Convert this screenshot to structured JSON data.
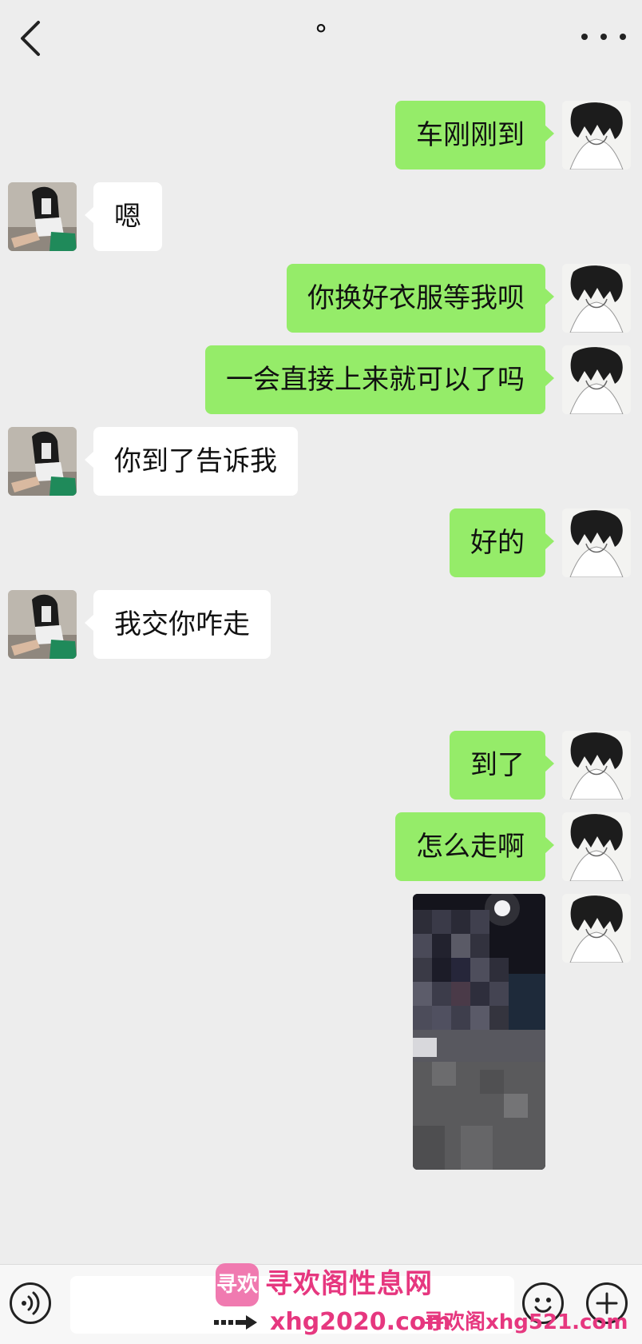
{
  "nav": {
    "title": "°"
  },
  "messages": [
    {
      "side": "me",
      "text": "车刚刚到"
    },
    {
      "side": "her",
      "text": "嗯"
    },
    {
      "side": "me",
      "text": "你换好衣服等我呗"
    },
    {
      "side": "me",
      "text": "一会直接上来就可以了吗"
    },
    {
      "side": "her",
      "text": "你到了告诉我"
    },
    {
      "side": "me",
      "text": "好的"
    },
    {
      "side": "her",
      "text": "我交你咋走"
    },
    {
      "side": "me",
      "text": "到了"
    },
    {
      "side": "me",
      "text": "怎么走啊"
    },
    {
      "side": "me",
      "type": "image"
    }
  ],
  "input": {
    "value": ""
  },
  "watermark": {
    "logo_text": "寻欢",
    "name": "寻欢阁性息网",
    "url1": "xhg2020.com",
    "url2": "寻欢阁xhg521.com"
  },
  "colors": {
    "background": "#ededed",
    "my_bubble": "#95ec69",
    "her_bubble": "#ffffff",
    "watermark": "#e6377f"
  },
  "icons": [
    "back-icon",
    "more-icon",
    "voice-icon",
    "emoji-icon",
    "plus-icon"
  ]
}
